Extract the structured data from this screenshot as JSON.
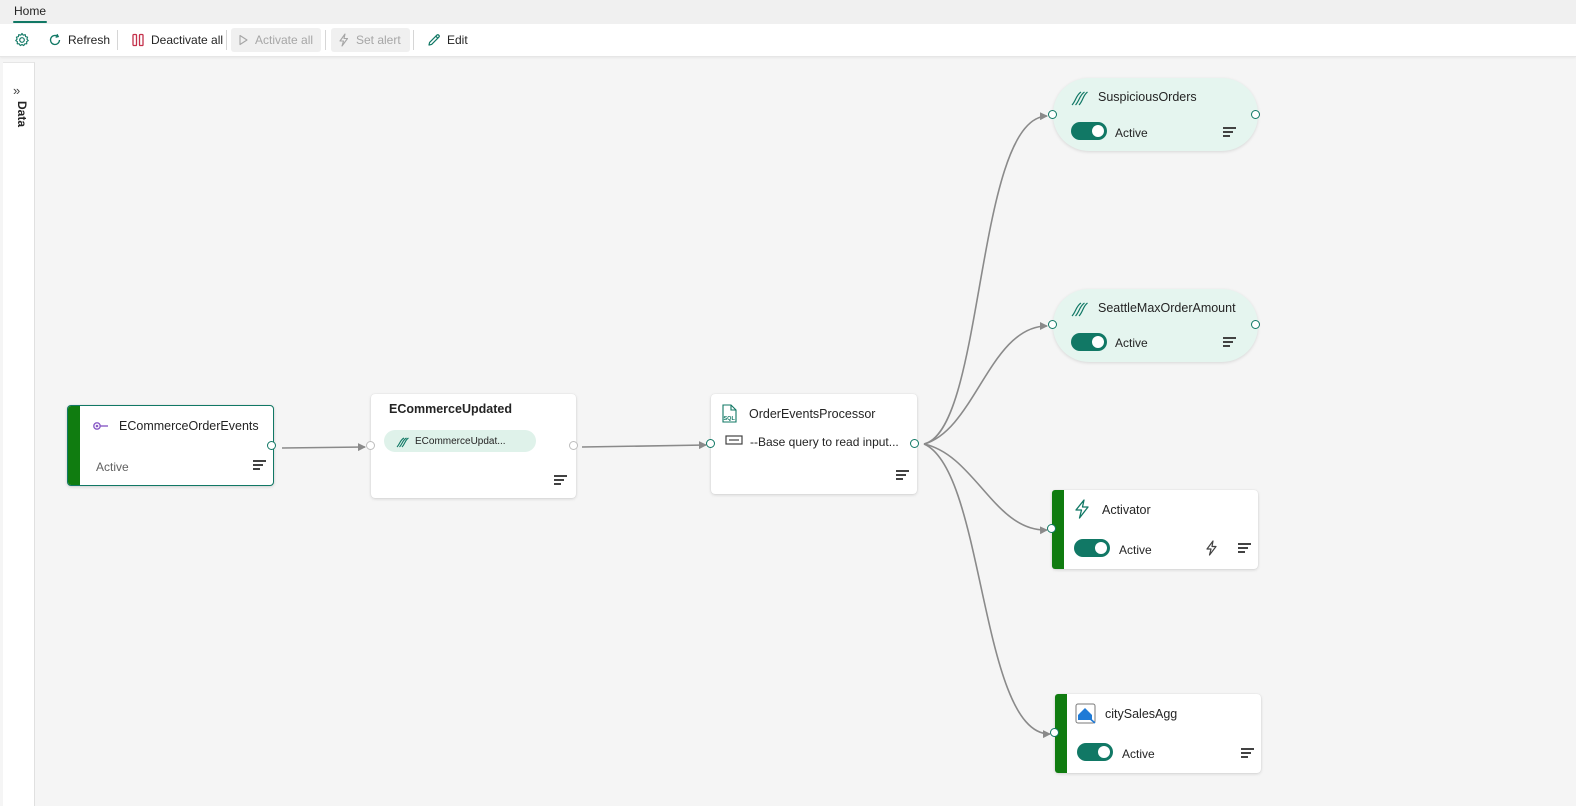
{
  "tabs": {
    "home": "Home"
  },
  "toolbar": {
    "refresh": "Refresh",
    "deactivate_all": "Deactivate all",
    "activate_all": "Activate all",
    "set_alert": "Set alert",
    "edit": "Edit"
  },
  "side_panel": {
    "label": "Data"
  },
  "nodes": {
    "source": {
      "title": "ECommerceOrderEvents",
      "status": "Active"
    },
    "stream": {
      "title": "ECommerceUpdated",
      "chip": "ECommerceUpdat..."
    },
    "processor": {
      "title": "OrderEventsProcessor",
      "query": "--Base query to read input..."
    },
    "suspicious": {
      "title": "SuspiciousOrders",
      "status": "Active"
    },
    "seattle": {
      "title": "SeattleMaxOrderAmount",
      "status": "Active"
    },
    "activator": {
      "title": "Activator",
      "status": "Active"
    },
    "city": {
      "title": "citySalesAgg",
      "status": "Active"
    }
  },
  "colors": {
    "accent": "#117865",
    "active_bar": "#107c10",
    "pill_bg": "#e5f5ef"
  }
}
